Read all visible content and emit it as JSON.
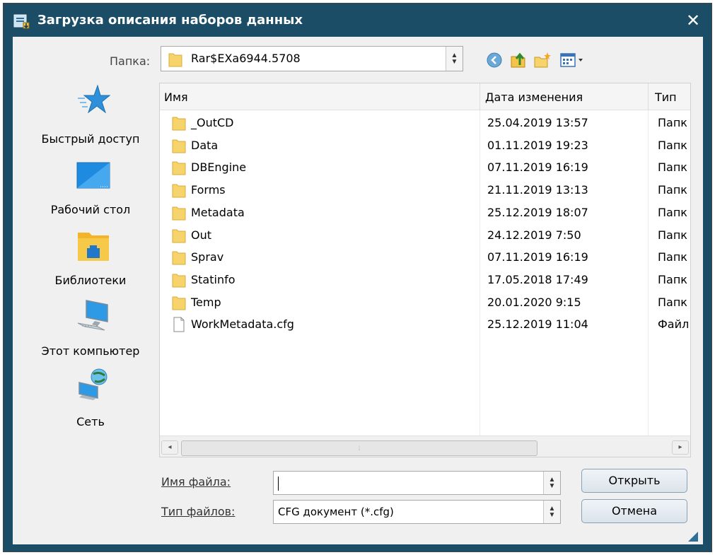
{
  "window": {
    "title": "Загрузка описания наборов данных",
    "close_glyph": "✕",
    "title_icon": "app-icon"
  },
  "folder_bar": {
    "label": "Папка:",
    "current_folder": "Rar$EXa6944.5708",
    "toolbar_icons": [
      "back-icon",
      "up-folder-icon",
      "new-folder-icon",
      "view-menu-icon"
    ]
  },
  "places": [
    {
      "label": "Быстрый доступ",
      "icon": "star-icon"
    },
    {
      "label": "Рабочий стол",
      "icon": "desktop-icon"
    },
    {
      "label": "Библиотеки",
      "icon": "libraries-icon"
    },
    {
      "label": "Этот компьютер",
      "icon": "computer-icon"
    },
    {
      "label": "Сеть",
      "icon": "network-icon"
    }
  ],
  "columns": {
    "name": "Имя",
    "date": "Дата изменения",
    "type": "Тип"
  },
  "files": [
    {
      "name": "_OutCD",
      "date": "25.04.2019 13:57",
      "type": "Папк",
      "kind": "folder"
    },
    {
      "name": "Data",
      "date": "01.11.2019 19:23",
      "type": "Папк",
      "kind": "folder"
    },
    {
      "name": "DBEngine",
      "date": "07.11.2019 16:19",
      "type": "Папк",
      "kind": "folder"
    },
    {
      "name": "Forms",
      "date": "21.11.2019 13:13",
      "type": "Папк",
      "kind": "folder"
    },
    {
      "name": "Metadata",
      "date": "25.12.2019 18:07",
      "type": "Папк",
      "kind": "folder"
    },
    {
      "name": "Out",
      "date": "24.12.2019 7:50",
      "type": "Папк",
      "kind": "folder"
    },
    {
      "name": "Sprav",
      "date": "07.11.2019 16:19",
      "type": "Папк",
      "kind": "folder"
    },
    {
      "name": "Statinfo",
      "date": "17.05.2018 17:49",
      "type": "Папк",
      "kind": "folder"
    },
    {
      "name": "Temp",
      "date": "20.01.2020 9:15",
      "type": "Папк",
      "kind": "folder"
    },
    {
      "name": "WorkMetadata.cfg",
      "date": "25.12.2019 11:04",
      "type": "Файл",
      "kind": "file"
    }
  ],
  "bottom": {
    "filename_label": "Имя файла:",
    "filename_value": "",
    "filetype_label": "Тип файлов:",
    "filetype_value": "CFG документ (*.cfg)",
    "open_label": "Открыть",
    "cancel_label": "Отмена"
  },
  "colors": {
    "titlebar": "#1b4e66",
    "folder_yellow": "#f6d36b",
    "accent_blue": "#2f8fd8"
  }
}
